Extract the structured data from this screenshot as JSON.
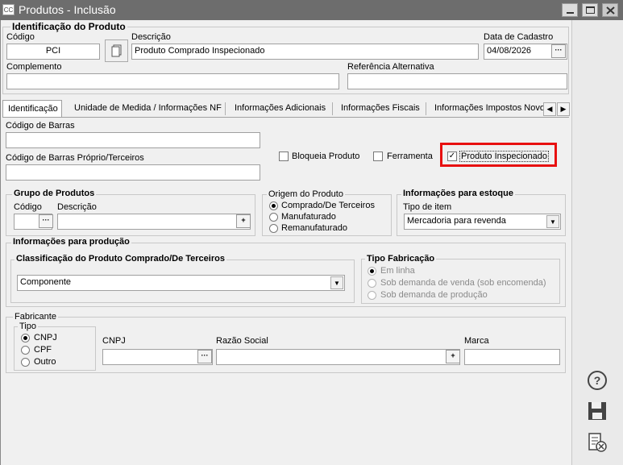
{
  "window": {
    "title": "Produtos - Inclusão",
    "app_icon": "CC"
  },
  "identificacao": {
    "legend": "Identificação do Produto",
    "codigo_label": "Código",
    "codigo_value": "PCI",
    "descricao_label": "Descrição",
    "descricao_value": "Produto Comprado Inspecionado",
    "data_label": "Data de Cadastro",
    "data_value": "04/08/2026",
    "complemento_label": "Complemento",
    "complemento_value": "",
    "ref_label": "Referência Alternativa",
    "ref_value": ""
  },
  "tabs": [
    "Identificação",
    "Unidade de Medida / Informações NF",
    "Informações Adicionais",
    "Informações Fiscais",
    "Informações Impostos Novo"
  ],
  "panel": {
    "barras_label": "Código de Barras",
    "barras_value": "",
    "barras_proprio_label": "Código de Barras Próprio/Terceiros",
    "barras_proprio_value": "",
    "bloqueia_label": "Bloqueia Produto",
    "ferramenta_label": "Ferramenta",
    "inspecionado_label": "Produto Inspecionado",
    "check_mark": "✓"
  },
  "grupo": {
    "legend": "Grupo de Produtos",
    "codigo_label": "Código",
    "descricao_label": "Descrição",
    "codigo_value": "",
    "descricao_value": ""
  },
  "origem": {
    "legend": "Origem do Produto",
    "options": [
      "Comprado/De Terceiros",
      "Manufaturado",
      "Remanufaturado"
    ]
  },
  "estoque": {
    "legend": "Informações para estoque",
    "tipo_label": "Tipo de item",
    "tipo_value": "Mercadoria para revenda"
  },
  "producao": {
    "legend": "Informações para produção",
    "classificacao_label": "Classificação do Produto Comprado/De Terceiros",
    "classificacao_value": "Componente",
    "fabricacao_label": "Tipo Fabricação",
    "fabricacao_options": [
      "Em linha",
      "Sob demanda de venda (sob encomenda)",
      "Sob demanda de produção"
    ]
  },
  "fabricante": {
    "legend": "Fabricante",
    "tipo_legend": "Tipo",
    "tipo_options": [
      "CNPJ",
      "CPF",
      "Outro"
    ],
    "cnpj_label": "CNPJ",
    "razao_label": "Razão Social",
    "marca_label": "Marca",
    "cnpj_value": "",
    "razao_value": "",
    "marca_value": ""
  },
  "highlight_color": "#e81010"
}
